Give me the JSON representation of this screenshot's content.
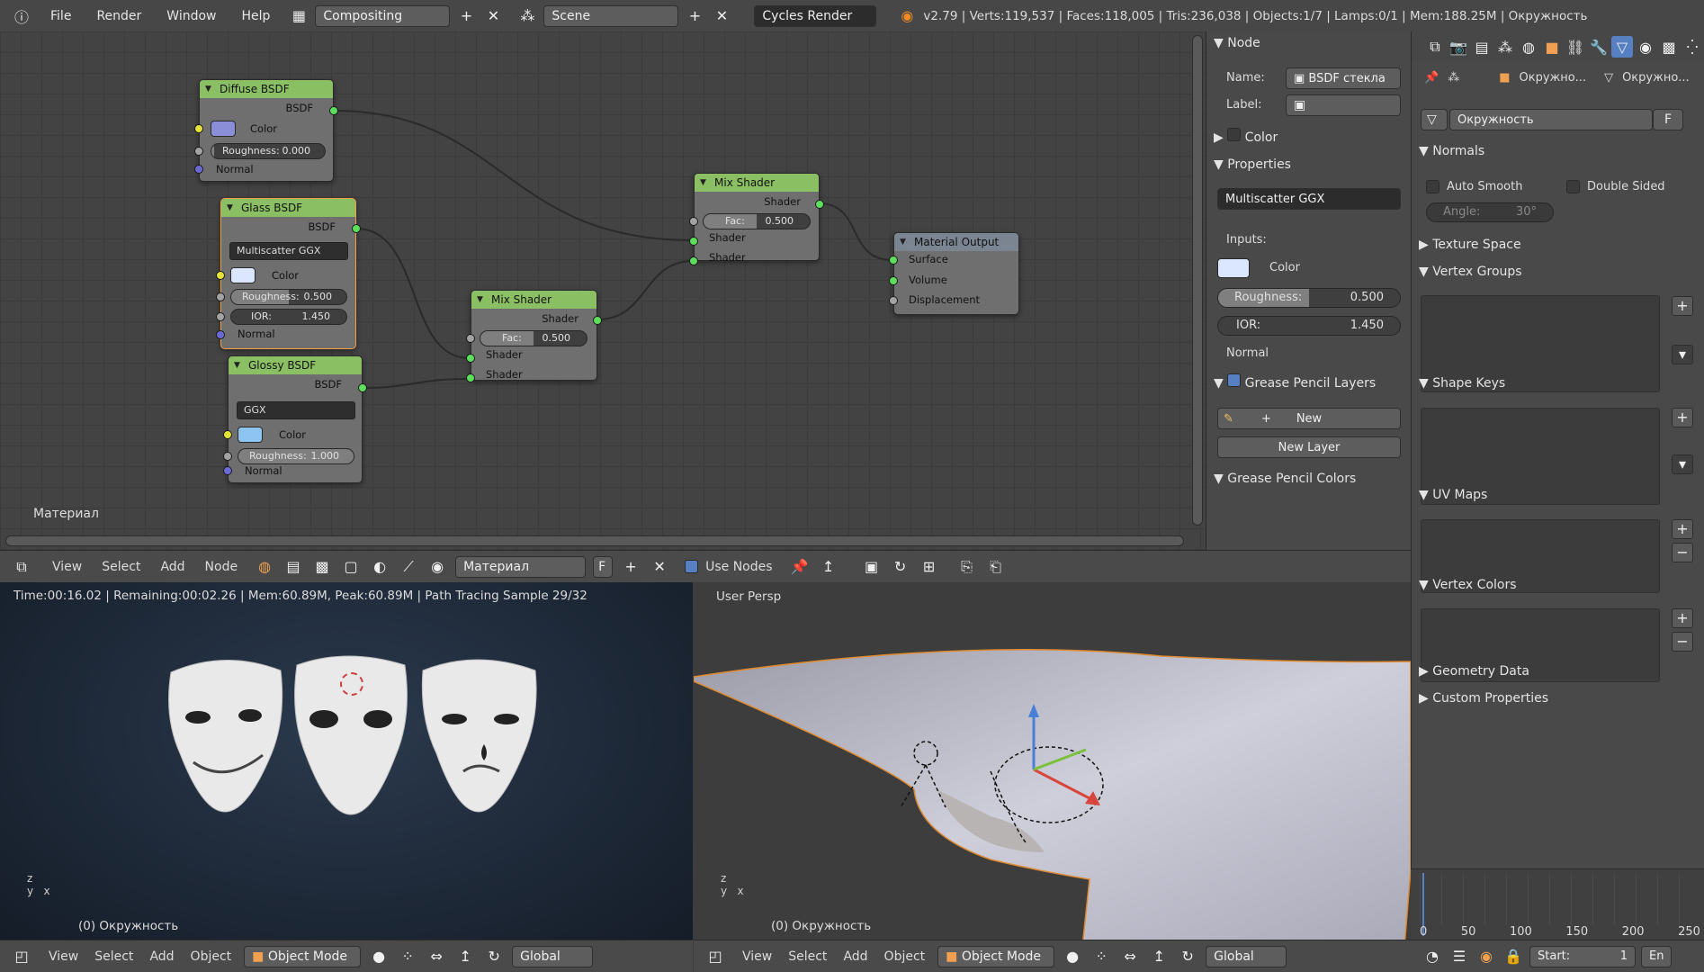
{
  "topbar": {
    "menu": [
      "File",
      "Render",
      "Window",
      "Help"
    ],
    "screen": "Compositing",
    "scene": "Scene",
    "engine": "Cycles Render",
    "stats": "v2.79 | Verts:119,537 | Faces:118,005 | Tris:236,038 | Objects:1/7 | Lamps:0/1 | Mem:188.25M | Окружность"
  },
  "node_editor": {
    "material_label": "Материал",
    "nodes": {
      "diffuse": {
        "title": "Diffuse BSDF",
        "out": "BSDF",
        "color": "Color",
        "roughness": "Roughness:",
        "roughness_val": "0.000",
        "normal": "Normal"
      },
      "glass": {
        "title": "Glass BSDF",
        "out": "BSDF",
        "dist": "Multiscatter GGX",
        "color": "Color",
        "roughness": "Roughness:",
        "roughness_val": "0.500",
        "ior": "IOR:",
        "ior_val": "1.450",
        "normal": "Normal"
      },
      "glossy": {
        "title": "Glossy BSDF",
        "out": "BSDF",
        "dist": "GGX",
        "color": "Color",
        "roughness": "Roughness:",
        "roughness_val": "1.000",
        "normal": "Normal"
      },
      "mix1": {
        "title": "Mix Shader",
        "out": "Shader",
        "fac": "Fac:",
        "fac_val": "0.500",
        "in1": "Shader",
        "in2": "Shader"
      },
      "mix2": {
        "title": "Mix Shader",
        "out": "Shader",
        "fac": "Fac:",
        "fac_val": "0.500",
        "in1": "Shader",
        "in2": "Shader"
      },
      "output": {
        "title": "Material Output",
        "surface": "Surface",
        "volume": "Volume",
        "displacement": "Displacement"
      }
    },
    "header": {
      "menu": [
        "View",
        "Select",
        "Add",
        "Node"
      ],
      "material": "Материал",
      "f": "F",
      "use_nodes": "Use Nodes"
    }
  },
  "node_sidebar": {
    "node_panel": "Node",
    "name_label": "Name:",
    "name_val": "BSDF стекла",
    "label_label": "Label:",
    "color_panel": "Color",
    "properties_panel": "Properties",
    "dist": "Multiscatter GGX",
    "inputs": "Inputs:",
    "color": "Color",
    "roughness": "Roughness:",
    "roughness_val": "0.500",
    "ior": "IOR:",
    "ior_val": "1.450",
    "normal": "Normal",
    "gp_layers": "Grease Pencil Layers",
    "new": "New",
    "new_layer": "New Layer",
    "gp_colors": "Grease Pencil Colors"
  },
  "render_view": {
    "info": "Time:00:16.02 | Remaining:00:02.26 | Mem:60.89M, Peak:60.89M | Path Tracing Sample 29/32",
    "object": "(0) Окружность"
  },
  "viewport": {
    "title": "User Persp",
    "object": "(0) Окружность"
  },
  "bottom": {
    "menu": [
      "View",
      "Select",
      "Add",
      "Object"
    ],
    "mode": "Object Mode",
    "orient": "Global"
  },
  "properties": {
    "crumb1": "Окружно...",
    "crumb2": "Окружно...",
    "mesh_name": "Окружность",
    "f": "F",
    "normals": "Normals",
    "auto_smooth": "Auto Smooth",
    "double_sided": "Double Sided",
    "angle": "Angle:",
    "angle_val": "30°",
    "texture_space": "Texture Space",
    "vertex_groups": "Vertex Groups",
    "shape_keys": "Shape Keys",
    "uv_maps": "UV Maps",
    "vertex_colors": "Vertex Colors",
    "geometry_data": "Geometry Data",
    "custom_properties": "Custom Properties"
  },
  "timeline": {
    "ticks": [
      "0",
      "50",
      "100",
      "150",
      "200",
      "250"
    ],
    "start": "Start:",
    "start_val": "1",
    "end_abbr": "En"
  },
  "colors": {
    "diffuse_swatch": "#8a8ed6",
    "glass_swatch": "#dbe6ff",
    "glossy_swatch": "#8ec4f0"
  }
}
